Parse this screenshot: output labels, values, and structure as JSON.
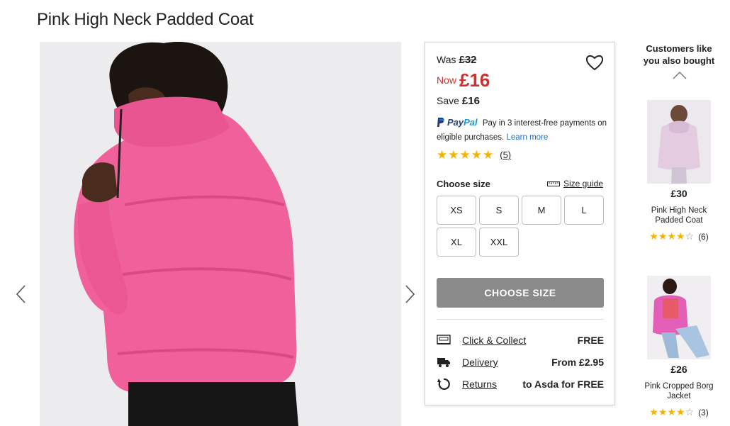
{
  "product": {
    "title": "Pink High Neck Padded Coat"
  },
  "pricing": {
    "was_label": "Was",
    "was_price": "£32",
    "now_label": "Now",
    "now_price": "£16",
    "save_label": "Save",
    "save_amount": "£16"
  },
  "paypal": {
    "logo_pay": "Pay",
    "logo_pal": "Pal",
    "text": "Pay in 3 interest-free payments on eligible purchases.",
    "link": "Learn more"
  },
  "rating": {
    "stars": 5,
    "count": "(5)"
  },
  "size": {
    "label": "Choose size",
    "guide": "Size guide",
    "options": [
      "XS",
      "S",
      "M",
      "L",
      "XL",
      "XXL"
    ],
    "cta": "CHOOSE SIZE"
  },
  "fulfilment": [
    {
      "icon": "store-icon",
      "label": "Click & Collect",
      "value": "FREE"
    },
    {
      "icon": "truck-icon",
      "label": "Delivery",
      "value": "From £2.95"
    },
    {
      "icon": "return-icon",
      "label": "Returns",
      "value": "to Asda for FREE"
    }
  ],
  "recommendations": {
    "heading": "Customers like you also bought",
    "items": [
      {
        "price": "£30",
        "name": "Pink High Neck Padded Coat",
        "stars": 4,
        "count": "(6)"
      },
      {
        "price": "£26",
        "name": "Pink Cropped Borg Jacket",
        "stars": 4,
        "count": "(3)"
      }
    ]
  },
  "colors": {
    "sale_red": "#d0312d",
    "star": "#f5b301",
    "coat_pink": "#f0609a",
    "link_blue": "#1a6fc4",
    "cta_grey": "#8a8a8a"
  }
}
